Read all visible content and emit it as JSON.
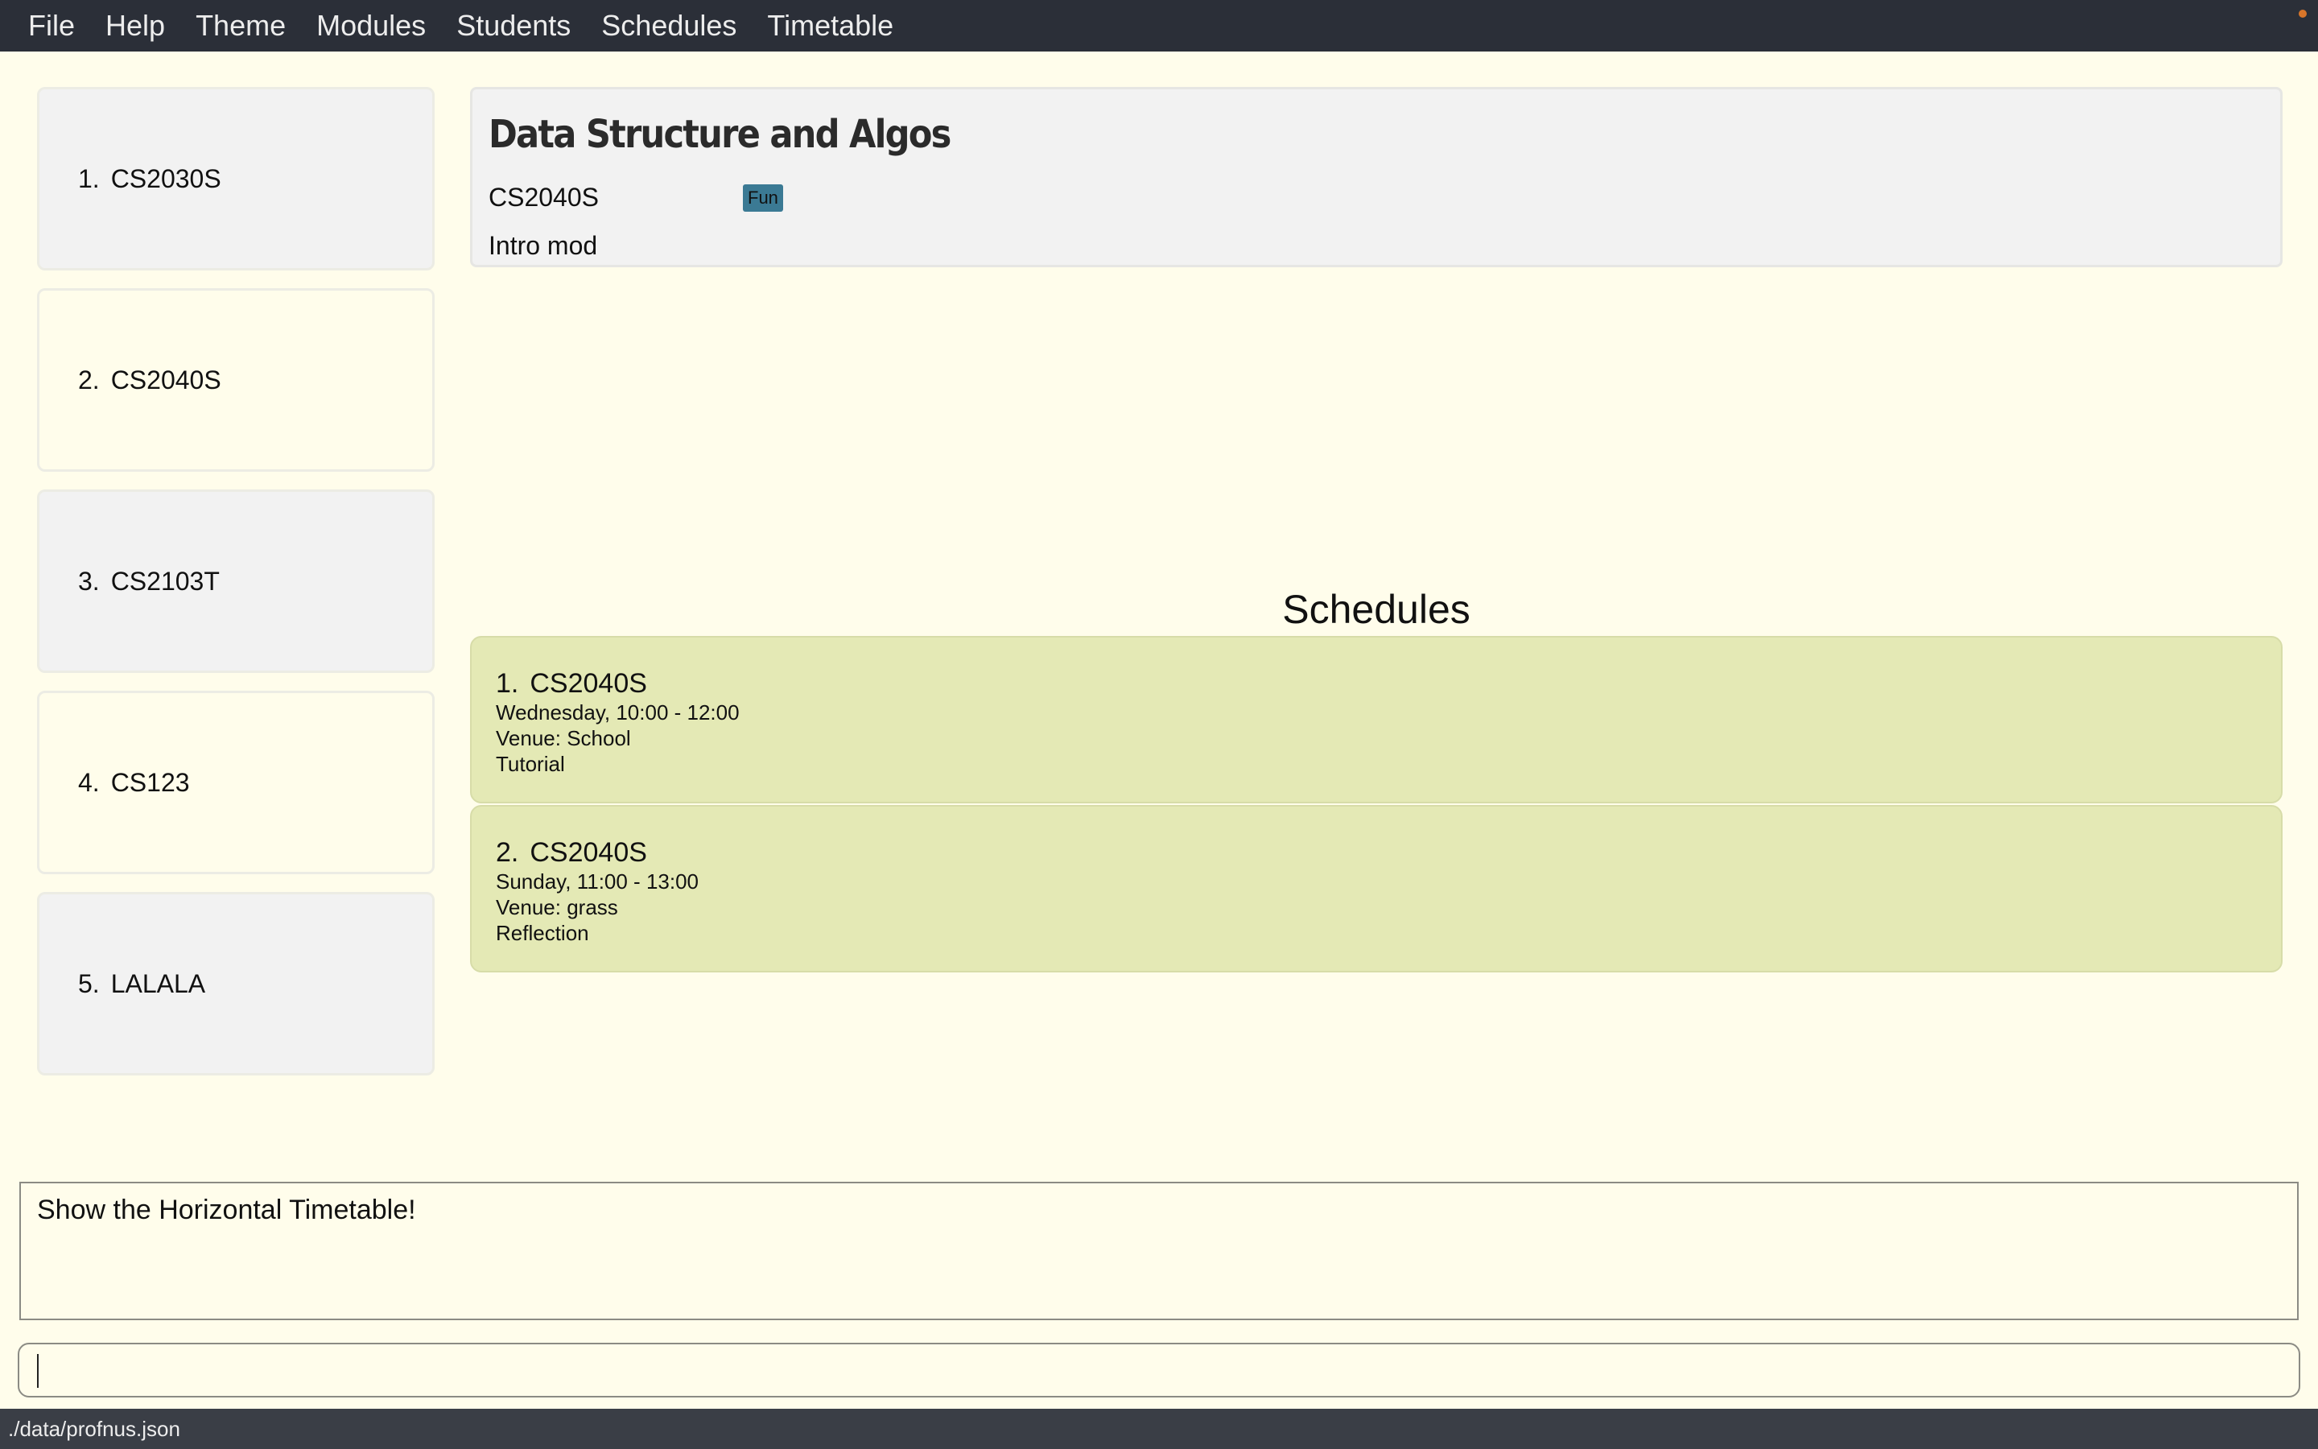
{
  "menubar": {
    "items": [
      "File",
      "Help",
      "Theme",
      "Modules",
      "Students",
      "Schedules",
      "Timetable"
    ]
  },
  "modules": [
    {
      "index": "1.",
      "code": "CS2030S"
    },
    {
      "index": "2.",
      "code": "CS2040S"
    },
    {
      "index": "3.",
      "code": "CS2103T"
    },
    {
      "index": "4.",
      "code": "CS123"
    },
    {
      "index": "5.",
      "code": "LALALA"
    }
  ],
  "module_detail": {
    "title": "Data Structure and Algos",
    "code": "CS2040S",
    "tag": "Fun",
    "description": "Intro mod"
  },
  "schedules": {
    "heading": "Schedules",
    "items": [
      {
        "index": "1.",
        "code": "CS2040S",
        "time": "Wednesday, 10:00 - 12:00",
        "venue": "Venue: School",
        "type": "Tutorial"
      },
      {
        "index": "2.",
        "code": "CS2040S",
        "time": "Sunday, 11:00 - 13:00",
        "venue": "Venue: grass",
        "type": "Reflection"
      }
    ]
  },
  "result_box": {
    "text": "Show the Horizontal Timetable!"
  },
  "command_box": {
    "value": ""
  },
  "status_bar": {
    "path": "./data/profnus.json"
  },
  "colors": {
    "background": "#FFFDEB",
    "menubar": "#2B2F38",
    "schedule_card": "#E4E9B5",
    "tag": "#3B7A94"
  }
}
